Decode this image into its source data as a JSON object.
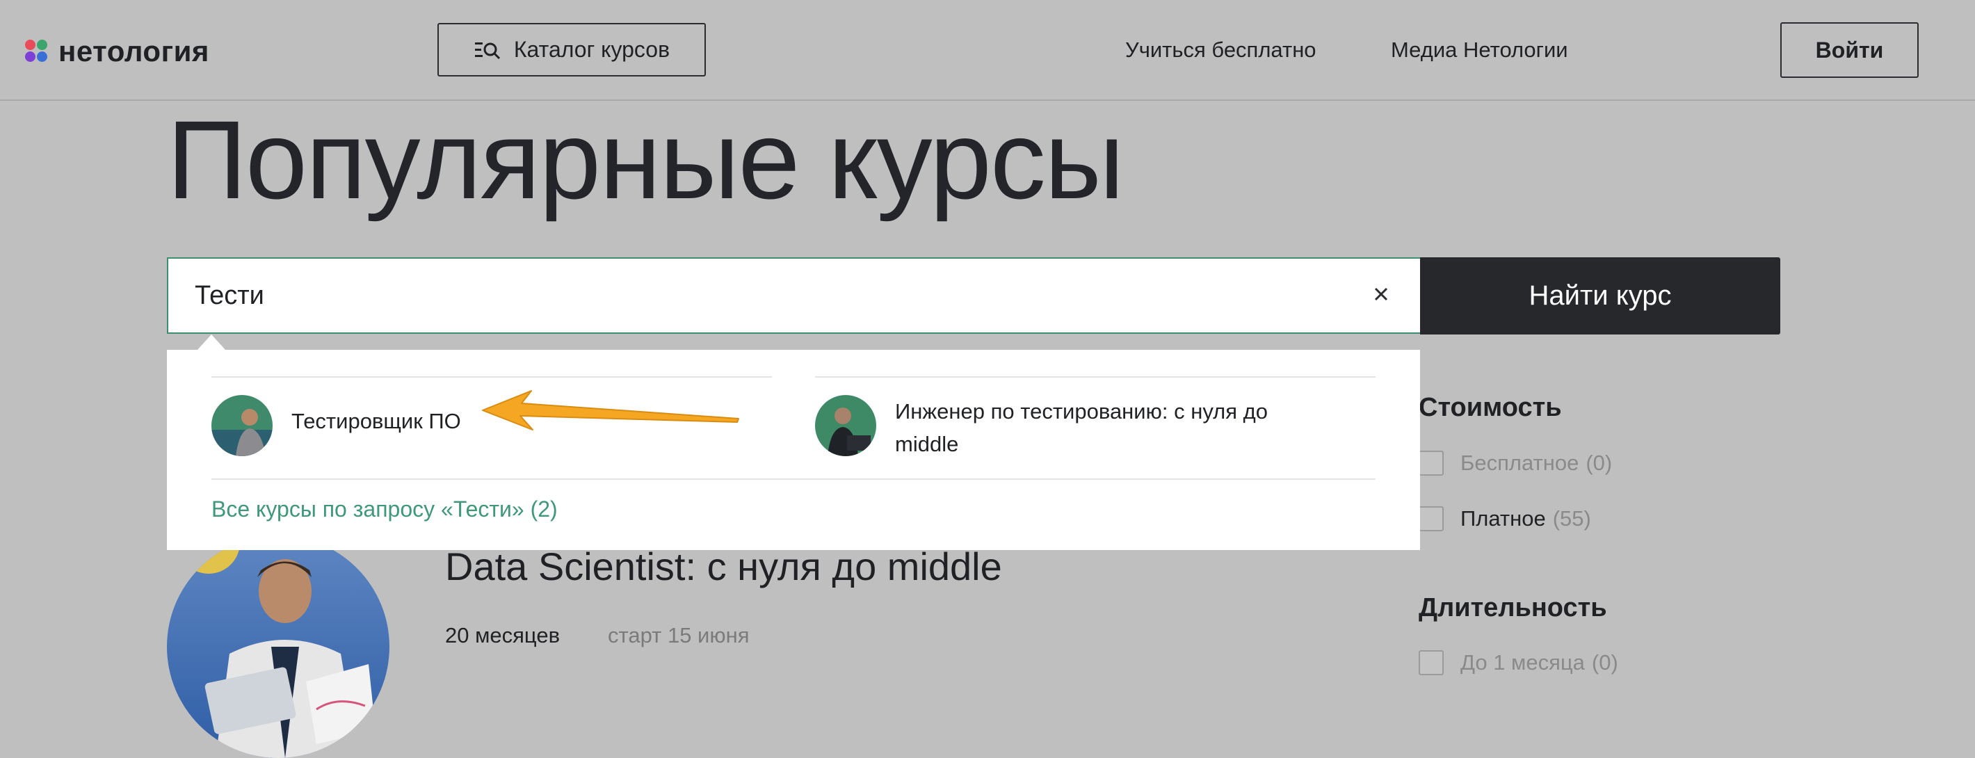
{
  "header": {
    "logo_text": "нетология",
    "catalog_button": "Каталог курсов",
    "catalog_icon": "list-search-icon",
    "nav": [
      "Учиться бесплатно",
      "Медиа Нетологии"
    ],
    "login_button": "Войти"
  },
  "page_title": "Популярные курсы",
  "search": {
    "value": "Тести",
    "clear_icon": "close-icon",
    "submit_label": "Найти курс"
  },
  "dropdown": {
    "suggestions": [
      {
        "label": "Тестировщик ПО"
      },
      {
        "label_line1": "Инженер по тестированию: с нуля до",
        "label_line2": "middle"
      }
    ],
    "all_results_link": "Все курсы по запросу «Тести» (2)"
  },
  "filters": {
    "cost": {
      "title": "Стоимость",
      "options": [
        {
          "label": "Бесплатное",
          "count": "(0)"
        },
        {
          "label": "Платное",
          "count": "(55)"
        }
      ]
    },
    "duration": {
      "title": "Длительность",
      "options": [
        {
          "label": "До 1 месяца",
          "count": "(0)"
        }
      ]
    }
  },
  "course": {
    "title": "Data Scientist: с нуля до middle",
    "duration": "20 месяцев",
    "start": "старт 15 июня"
  },
  "colors": {
    "overlay_bg": "#bfbfbf",
    "accent_green": "#3f9878",
    "dark_button": "#26282c",
    "arrow": "#f5a623"
  }
}
